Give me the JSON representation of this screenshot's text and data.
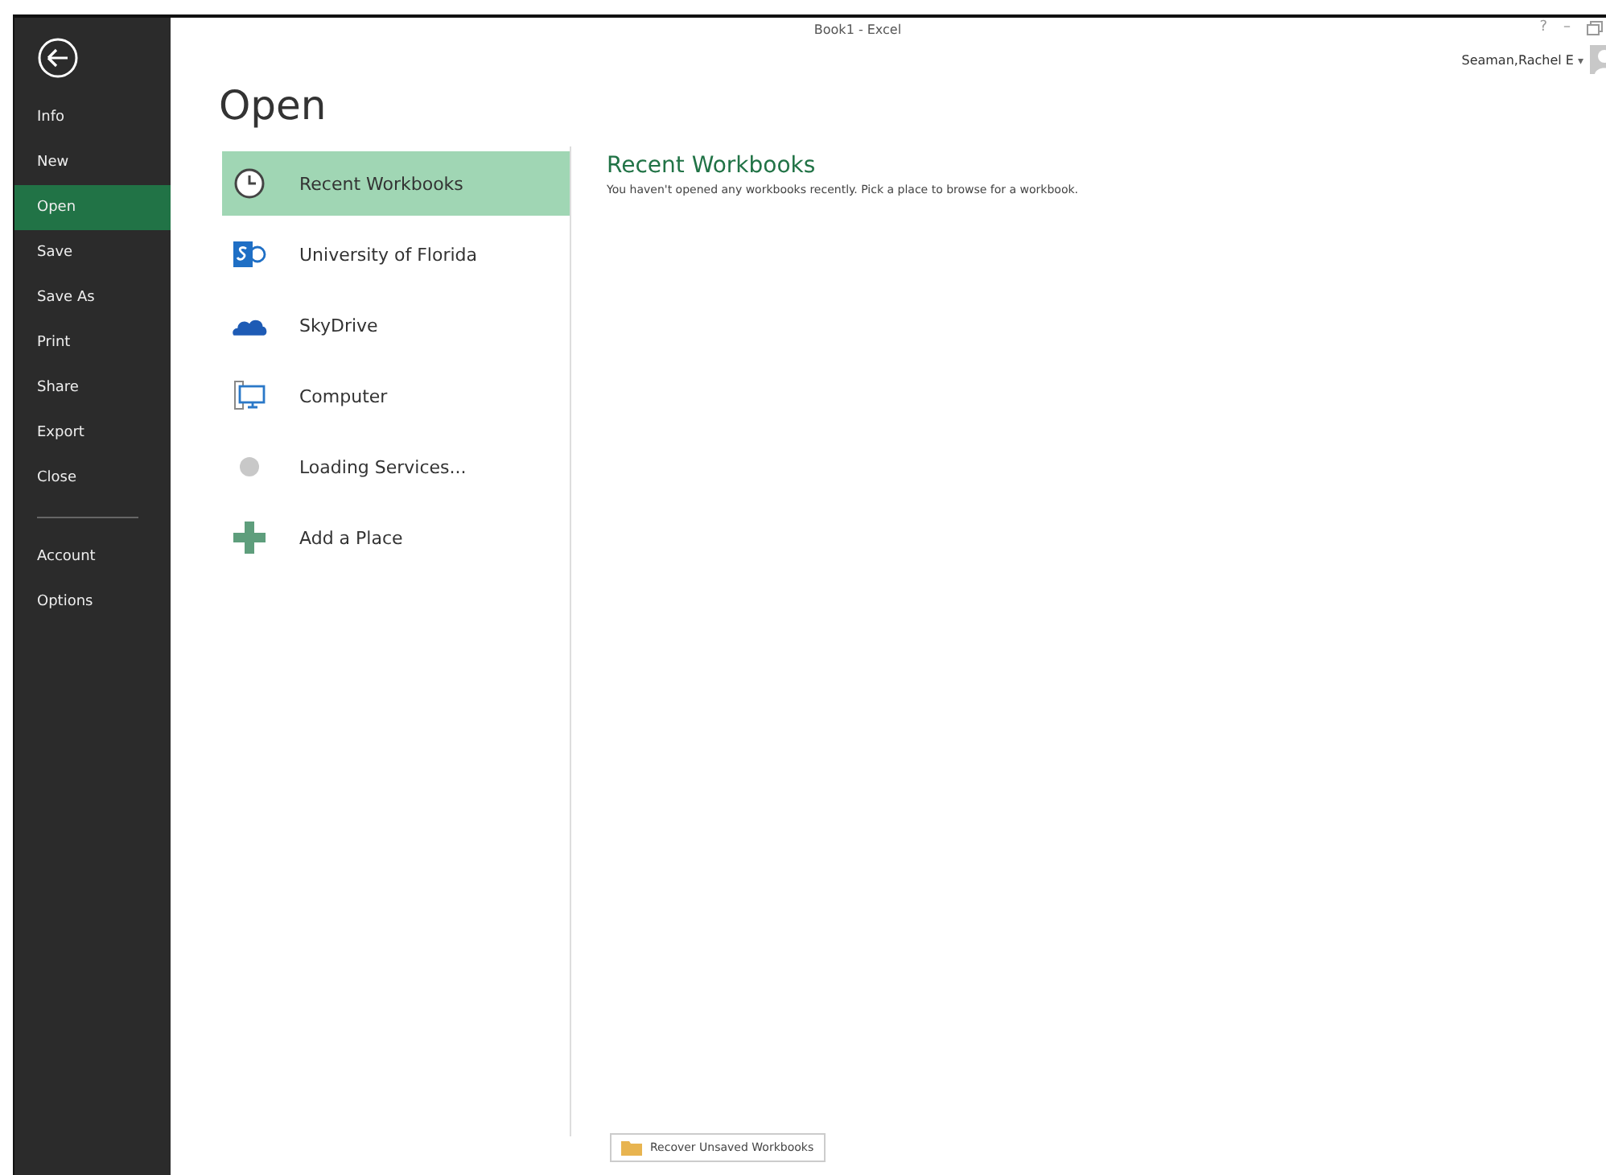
{
  "window": {
    "title": "Book1 - Excel",
    "help": "?",
    "minimize": "–"
  },
  "user": {
    "name": "Seaman,Rachel E",
    "caret": "▾"
  },
  "backstage_nav": [
    {
      "label": "Info",
      "selected": false
    },
    {
      "label": "New",
      "selected": false
    },
    {
      "label": "Open",
      "selected": true
    },
    {
      "label": "Save",
      "selected": false
    },
    {
      "label": "Save As",
      "selected": false
    },
    {
      "label": "Print",
      "selected": false
    },
    {
      "label": "Share",
      "selected": false
    },
    {
      "label": "Export",
      "selected": false
    },
    {
      "label": "Close",
      "selected": false
    },
    {
      "label": "Account",
      "selected": false,
      "separator_before": true
    },
    {
      "label": "Options",
      "selected": false
    }
  ],
  "page_title": "Open",
  "places": [
    {
      "label": "Recent Workbooks",
      "kind": "clock",
      "selected": true
    },
    {
      "label": "University of Florida",
      "kind": "sharepoint",
      "selected": false
    },
    {
      "label": "SkyDrive",
      "kind": "cloud",
      "selected": false
    },
    {
      "label": "Computer",
      "kind": "computer",
      "selected": false
    },
    {
      "label": "Loading Services...",
      "kind": "loading",
      "selected": false
    },
    {
      "label": "Add a Place",
      "kind": "add",
      "selected": false
    }
  ],
  "detail": {
    "heading": "Recent Workbooks",
    "message": "You haven't opened any workbooks recently. Pick a place to browse for a workbook."
  },
  "recover_button": "Recover Unsaved Workbooks"
}
